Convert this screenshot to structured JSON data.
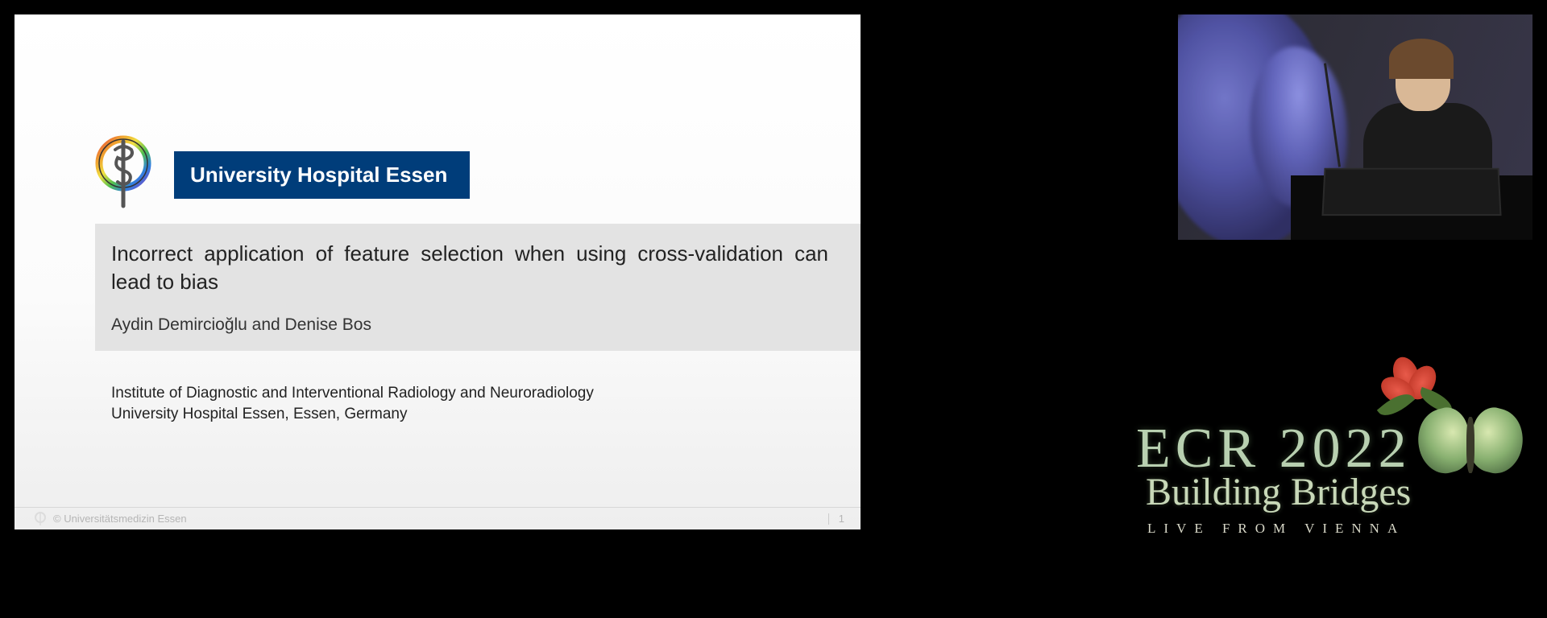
{
  "slide": {
    "organization": "University Hospital Essen",
    "title": "Incorrect application of feature selection when using cross-validation can lead to bias",
    "authors": "Aydin Demircioğlu and Denise Bos",
    "affiliation_line1": "Institute of Diagnostic and Interventional Radiology and Neuroradiology",
    "affiliation_line2": "University Hospital Essen, Essen, Germany",
    "footer_copyright": "© Universitätsmedizin Essen",
    "page_number": "1"
  },
  "event_logo": {
    "main": "ECR 2022",
    "script": "Building Bridges",
    "sub": "LIVE FROM VIENNA"
  }
}
